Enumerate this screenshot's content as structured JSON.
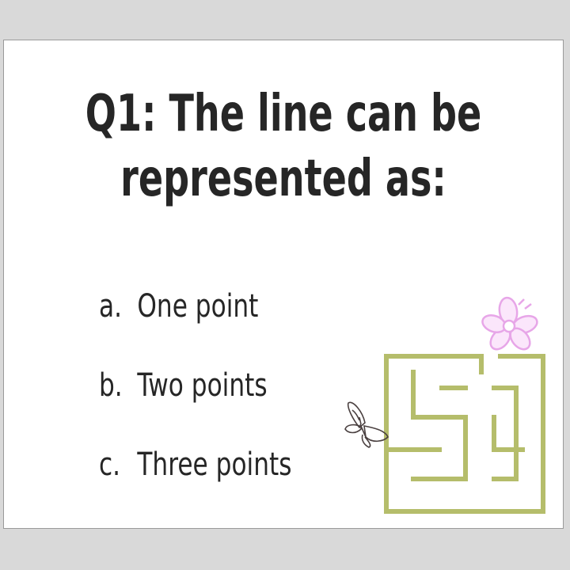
{
  "question": {
    "line1": "Q1: The line can be",
    "line2": "represented as:"
  },
  "options": [
    {
      "letter": "a.",
      "text": "One point"
    },
    {
      "letter": "b.",
      "text": "Two points"
    },
    {
      "letter": "c.",
      "text": "Three points"
    }
  ],
  "colors": {
    "background": "#d9d9d9",
    "slide": "#ffffff",
    "text": "#262626",
    "maze": "#b5bd6b",
    "flower": "#e7a6e8",
    "butterfly": "#4a4040"
  },
  "icons": [
    "maze-icon",
    "flower-icon",
    "butterfly-icon"
  ]
}
